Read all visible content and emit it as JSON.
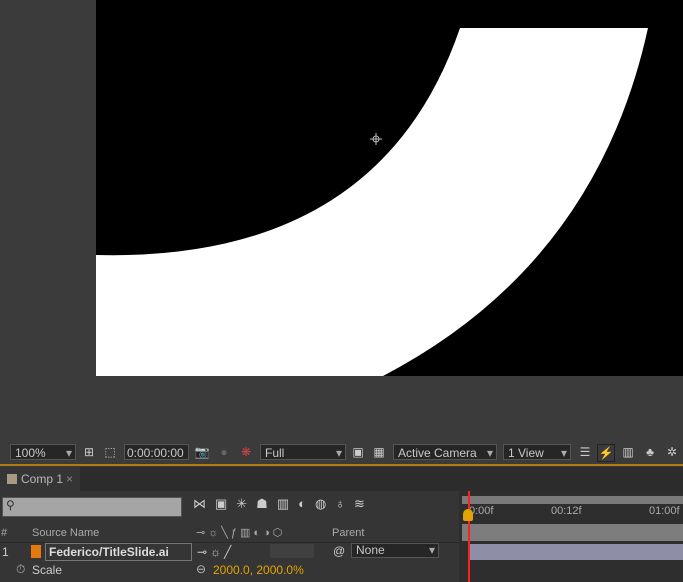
{
  "toolbar": {
    "zoom": "100%",
    "timecode": "0:00:00:00",
    "resolution": "Full",
    "camera": "Active Camera",
    "views": "1 View"
  },
  "panel": {
    "tab_label": "Comp 1",
    "close": "×"
  },
  "timeline": {
    "search_placeholder": "",
    "ruler": [
      "0:00f",
      "00:12f",
      "01:00f"
    ],
    "columns": {
      "num": "#",
      "source": "Source Name",
      "parent": "Parent"
    },
    "layers": [
      {
        "index": "1",
        "name": "Federico/TitleSlide.ai",
        "parent": "None",
        "property": "Scale",
        "value": "2000.0, 2000.0%"
      }
    ]
  },
  "colors": {
    "accent": "#e2a400",
    "playhead": "#ff2020",
    "layer_bar": "#8e8ea8"
  }
}
